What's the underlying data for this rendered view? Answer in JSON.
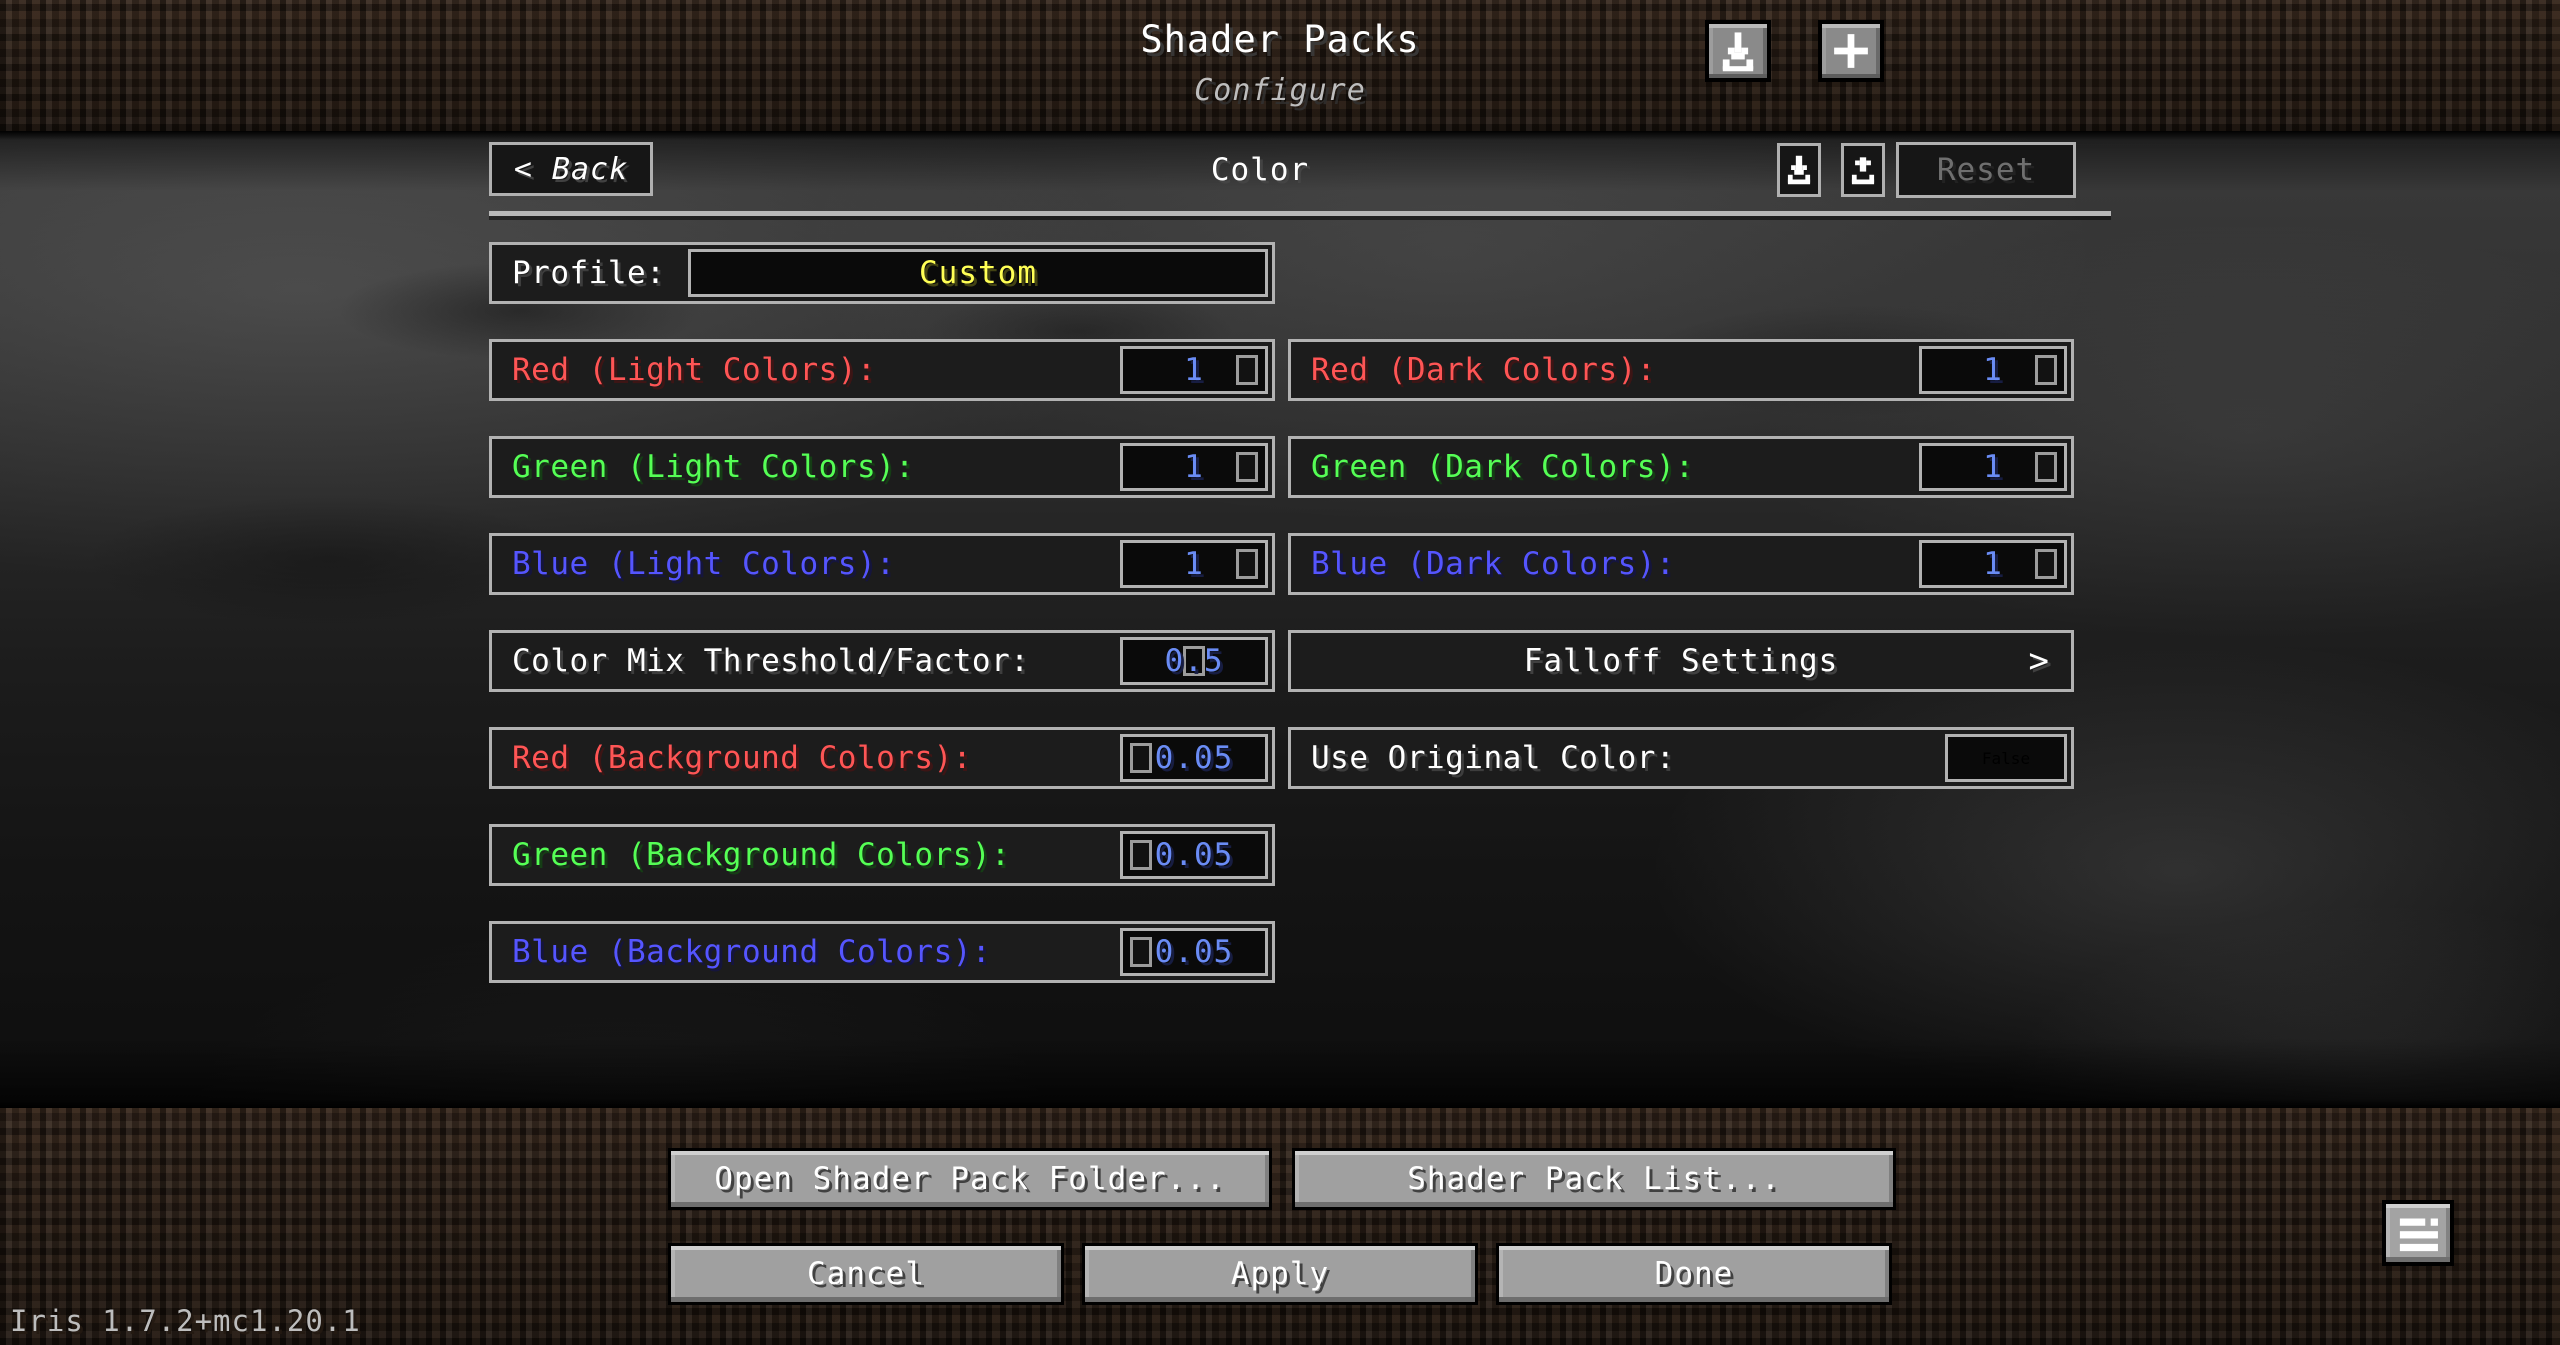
{
  "header": {
    "title": "Shader Packs",
    "subtitle": "Configure",
    "import_icon": "download-icon",
    "add_icon": "plus-icon"
  },
  "subheader": {
    "back_label": "< Back",
    "page_title": "Color",
    "import_icon": "import-icon",
    "export_icon": "export-icon",
    "reset_label": "Reset"
  },
  "profile": {
    "label": "Profile:",
    "value": "Custom",
    "value_color": "#ffff55"
  },
  "options": {
    "left": [
      {
        "label": "Red (Light Colors):",
        "color": "red",
        "value": "1",
        "handle": "right",
        "kind": "slider"
      },
      {
        "label": "Green (Light Colors):",
        "color": "green",
        "value": "1",
        "handle": "right",
        "kind": "slider"
      },
      {
        "label": "Blue (Light Colors):",
        "color": "blue",
        "value": "1",
        "handle": "right",
        "kind": "slider"
      },
      {
        "label": "Color Mix Threshold/Factor:",
        "color": "white",
        "value": "0.5",
        "handle": "mid",
        "kind": "slider"
      },
      {
        "label": "Red (Background Colors):",
        "color": "red",
        "value": "0.05",
        "handle": "left",
        "kind": "slider"
      },
      {
        "label": "Green (Background Colors):",
        "color": "green",
        "value": "0.05",
        "handle": "left",
        "kind": "slider"
      },
      {
        "label": "Blue (Background Colors):",
        "color": "blue",
        "value": "0.05",
        "handle": "left",
        "kind": "slider"
      }
    ],
    "right": [
      {
        "label": "Red (Dark Colors):",
        "color": "red",
        "value": "1",
        "handle": "right",
        "kind": "slider"
      },
      {
        "label": "Green (Dark Colors):",
        "color": "green",
        "value": "1",
        "handle": "right",
        "kind": "slider"
      },
      {
        "label": "Blue (Dark Colors):",
        "color": "blue",
        "value": "1",
        "handle": "right",
        "kind": "slider"
      },
      {
        "label": "Falloff Settings",
        "color": "white",
        "value": "",
        "handle": "",
        "kind": "submenu",
        "chevron": ">"
      },
      {
        "label": "Use Original Color:",
        "color": "white",
        "value": "False",
        "handle": "",
        "kind": "boolean"
      }
    ]
  },
  "footer": {
    "open_folder_label": "Open Shader Pack Folder...",
    "pack_list_label": "Shader Pack List...",
    "cancel_label": "Cancel",
    "apply_label": "Apply",
    "done_label": "Done",
    "corner_icon": "list-options-icon",
    "version": "Iris 1.7.2+mc1.20.1"
  },
  "colors": {
    "label_red": "#ff5555",
    "label_green": "#55ff55",
    "label_blue": "#5555ff",
    "value_blue": "#6a8cf5",
    "value_false_red": "#ff2020",
    "profile_yellow": "#ffff55",
    "border_gray": "#b2b2b2"
  }
}
